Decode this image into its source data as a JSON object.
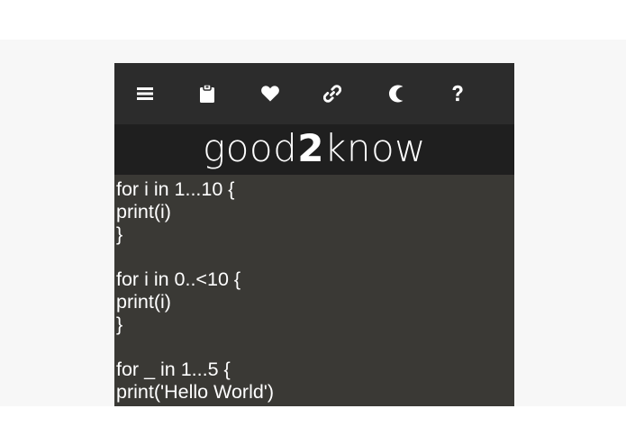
{
  "toolbar": {
    "icons": [
      "menu-icon",
      "clipboard-icon",
      "heart-icon",
      "link-icon",
      "moon-icon",
      "question-icon"
    ],
    "icon_color": "#ffffff",
    "background": "#2c2c2c"
  },
  "title": {
    "prefix": "good",
    "bold": "2",
    "suffix": "know"
  },
  "code": {
    "lines": [
      "for i in 1...10 {",
      "print(i)",
      "}",
      "",
      "for i in 0..<10 {",
      "print(i)",
      "}",
      "",
      "for _ in 1...5 {",
      "print('Hello World')"
    ]
  },
  "colors": {
    "code_background": "#3a3935",
    "title_background": "#1f1f1f",
    "text": "#ffffff"
  }
}
